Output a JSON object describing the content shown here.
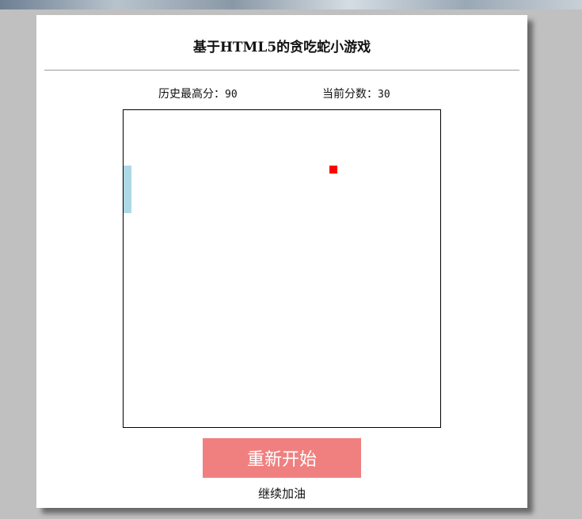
{
  "game": {
    "title": "基于HTML5的贪吃蛇小游戏",
    "best_label": "历史最高分：",
    "best_value": "90",
    "current_label": "当前分数：",
    "current_value": "30",
    "restart_label": "重新开始",
    "status_text": "继续加油"
  },
  "colors": {
    "snake": "#add8e6",
    "food": "#ff0000",
    "restart_button": "#f08080"
  },
  "board": {
    "grid_cols": 40,
    "grid_rows": 40,
    "snake": [
      [
        0,
        7
      ],
      [
        0,
        8
      ],
      [
        0,
        9
      ],
      [
        0,
        10
      ],
      [
        0,
        11
      ],
      [
        0,
        12
      ]
    ],
    "food": [
      26,
      7
    ]
  }
}
